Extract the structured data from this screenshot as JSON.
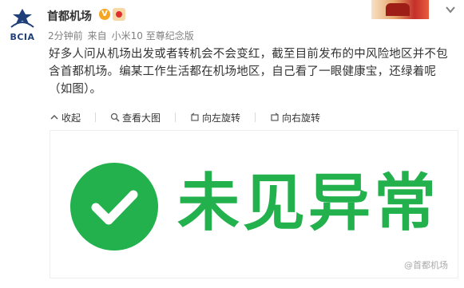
{
  "header": {
    "avatar_text": "BCIA",
    "username": "首都机场",
    "verified_mark": "V",
    "meta": {
      "time": "2分钟前",
      "source_prefix": "来自",
      "source": "小米10 至尊纪念版"
    }
  },
  "post": {
    "text": "好多人问从机场出发或者转机会不会变红，截至目前发布的中风险地区并不包含首都机场。编某工作生活都在机场地区，自己看了一眼健康宝，还绿着呢（如图）。"
  },
  "toolbar": {
    "collapse_label": "收起",
    "view_large_label": "查看大图",
    "rotate_left_label": "向左旋转",
    "rotate_right_label": "向右旋转"
  },
  "image": {
    "status_text": "未见异常",
    "watermark": "@首都机场"
  },
  "colors": {
    "status_green": "#22b14c",
    "meta_gray": "#808080",
    "text": "#333333",
    "brand_navy": "#1f3f7a"
  }
}
